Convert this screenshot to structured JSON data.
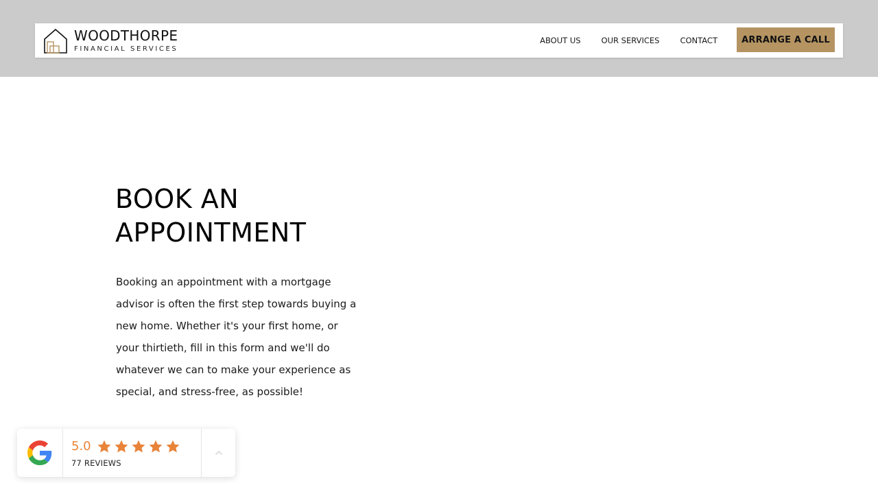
{
  "brand": {
    "name": "WOODTHORPE",
    "subtitle": "FINANCIAL SERVICES",
    "logo_icon": "house-outline-icon"
  },
  "nav": {
    "items": [
      {
        "label": "ABOUT US"
      },
      {
        "label": "OUR SERVICES"
      },
      {
        "label": "CONTACT"
      }
    ],
    "cta_label": "ARRANGE A CALL"
  },
  "hero": {
    "title_line1": "BOOK AN",
    "title_line2": "APPOINTMENT",
    "body": "Booking an appointment with a mortgage advisor is often the first step towards buying a new home. Whether it's your first home, or your thirtieth, fill in this form and we'll do whatever we can to make your experience as special, and stress-free, as possible!"
  },
  "reviews": {
    "provider_icon": "google-icon",
    "score": "5.0",
    "stars": 5,
    "count_label": "77 REVIEWS",
    "toggle_icon": "chevron-up-icon"
  },
  "colors": {
    "top_band": "#cbcbcb",
    "accent_gold": "#b59462",
    "star_orange": "#e8843a"
  }
}
